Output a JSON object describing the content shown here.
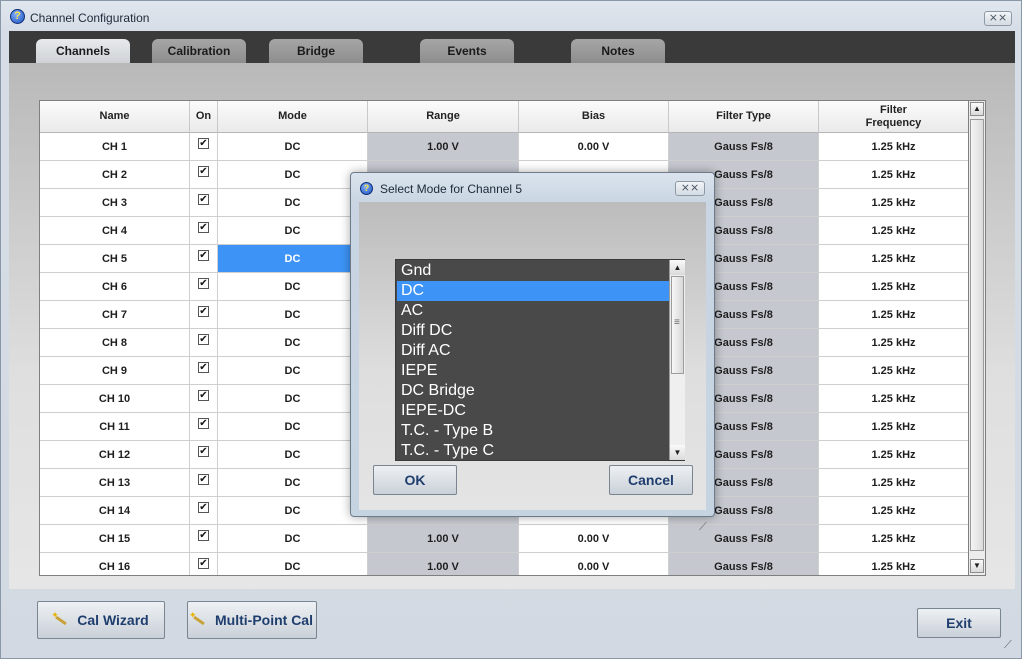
{
  "window": {
    "title": "Channel Configuration",
    "close_label": "⨯⨯"
  },
  "tabs": [
    {
      "label": "Channels",
      "active": true
    },
    {
      "label": "Calibration",
      "active": false
    },
    {
      "label": "Bridge",
      "active": false
    },
    {
      "label": "Events",
      "active": false
    },
    {
      "label": "Notes",
      "active": false
    }
  ],
  "grid": {
    "headers": {
      "name": "Name",
      "on": "On",
      "mode": "Mode",
      "range": "Range",
      "bias": "Bias",
      "filter_type": "Filter Type",
      "filter_frequency": "Filter\nFrequency"
    },
    "rows": [
      {
        "name": "CH 1",
        "on": "✔",
        "mode": "DC",
        "range": "1.00  V",
        "bias": "0.00  V",
        "filter_type": "Gauss Fs/8",
        "filter_frequency": "1.25 kHz"
      },
      {
        "name": "CH 2",
        "on": "✔",
        "mode": "DC",
        "range": "",
        "bias": "",
        "filter_type": "Gauss Fs/8",
        "filter_frequency": "1.25 kHz"
      },
      {
        "name": "CH 3",
        "on": "✔",
        "mode": "DC",
        "range": "",
        "bias": "",
        "filter_type": "Gauss Fs/8",
        "filter_frequency": "1.25 kHz"
      },
      {
        "name": "CH 4",
        "on": "✔",
        "mode": "DC",
        "range": "",
        "bias": "",
        "filter_type": "Gauss Fs/8",
        "filter_frequency": "1.25 kHz"
      },
      {
        "name": "CH 5",
        "on": "✔",
        "mode": "DC",
        "range": "",
        "bias": "",
        "filter_type": "Gauss Fs/8",
        "filter_frequency": "1.25 kHz"
      },
      {
        "name": "CH 6",
        "on": "✔",
        "mode": "DC",
        "range": "",
        "bias": "",
        "filter_type": "Gauss Fs/8",
        "filter_frequency": "1.25 kHz"
      },
      {
        "name": "CH 7",
        "on": "✔",
        "mode": "DC",
        "range": "",
        "bias": "",
        "filter_type": "Gauss Fs/8",
        "filter_frequency": "1.25 kHz"
      },
      {
        "name": "CH 8",
        "on": "✔",
        "mode": "DC",
        "range": "",
        "bias": "",
        "filter_type": "Gauss Fs/8",
        "filter_frequency": "1.25 kHz"
      },
      {
        "name": "CH 9",
        "on": "✔",
        "mode": "DC",
        "range": "",
        "bias": "",
        "filter_type": "Gauss Fs/8",
        "filter_frequency": "1.25 kHz"
      },
      {
        "name": "CH 10",
        "on": "✔",
        "mode": "DC",
        "range": "",
        "bias": "",
        "filter_type": "Gauss Fs/8",
        "filter_frequency": "1.25 kHz"
      },
      {
        "name": "CH 11",
        "on": "✔",
        "mode": "DC",
        "range": "",
        "bias": "",
        "filter_type": "Gauss Fs/8",
        "filter_frequency": "1.25 kHz"
      },
      {
        "name": "CH 12",
        "on": "✔",
        "mode": "DC",
        "range": "",
        "bias": "",
        "filter_type": "Gauss Fs/8",
        "filter_frequency": "1.25 kHz"
      },
      {
        "name": "CH 13",
        "on": "✔",
        "mode": "DC",
        "range": "",
        "bias": "",
        "filter_type": "Gauss Fs/8",
        "filter_frequency": "1.25 kHz"
      },
      {
        "name": "CH 14",
        "on": "✔",
        "mode": "DC",
        "range": "",
        "bias": "",
        "filter_type": "Gauss Fs/8",
        "filter_frequency": "1.25 kHz"
      },
      {
        "name": "CH 15",
        "on": "✔",
        "mode": "DC",
        "range": "1.00  V",
        "bias": "0.00  V",
        "filter_type": "Gauss Fs/8",
        "filter_frequency": "1.25 kHz"
      },
      {
        "name": "CH 16",
        "on": "✔",
        "mode": "DC",
        "range": "1.00  V",
        "bias": "0.00  V",
        "filter_type": "Gauss Fs/8",
        "filter_frequency": "1.25 kHz"
      }
    ],
    "selected_row": 5,
    "scroll_up": "▲",
    "scroll_down": "▼"
  },
  "buttons": {
    "cal_wizard": "Cal Wizard",
    "multi_point_cal": "Multi-Point Cal",
    "exit": "Exit"
  },
  "dialog": {
    "title": "Select Mode for Channel 5",
    "close_label": "⨯⨯",
    "options": [
      "Gnd",
      "DC",
      "AC",
      "Diff DC",
      "Diff AC",
      "IEPE",
      "DC Bridge",
      "IEPE-DC",
      "T.C. - Type B",
      "T.C. - Type C"
    ],
    "selected_option": "DC",
    "scroll_up": "▲",
    "scroll_down": "▼",
    "ok_label": "OK",
    "cancel_label": "Cancel"
  },
  "colors": {
    "selection": "#3d94f6",
    "list_background": "#494949",
    "tab_strip": "#3a3a3a"
  }
}
